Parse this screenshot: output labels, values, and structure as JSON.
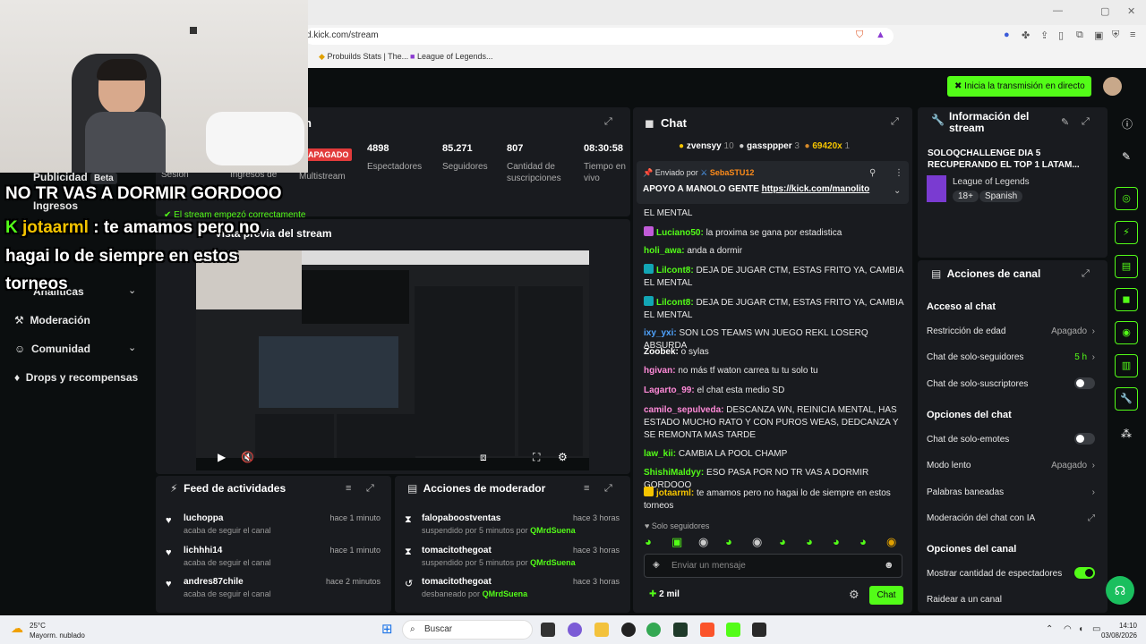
{
  "browser": {
    "url": "d.kick.com/stream",
    "bookmarks": [
      "Probuilds Stats | The...",
      "League of Legends..."
    ]
  },
  "header": {
    "golive_label": "Inicia la transmisión en directo"
  },
  "sidebar": {
    "items": [
      {
        "label": "Publicidad",
        "badge": "Beta"
      },
      {
        "label": "Ingresos"
      },
      {
        "label": "Analíticas"
      },
      {
        "label": "Moderación"
      },
      {
        "label": "Comunidad"
      },
      {
        "label": "Drops y recompensas"
      }
    ]
  },
  "stream_panel": {
    "title": "n",
    "status": "El stream empezó correctamente",
    "sesion_label": "Sesión",
    "ingresos_label": "Ingresos de",
    "paid_badge": "APAGADO",
    "multistream": "Multistream",
    "stats": [
      {
        "value": "4898",
        "label": "Espectadores"
      },
      {
        "value": "85.271",
        "label": "Seguidores"
      },
      {
        "value": "807",
        "label": "Cantidad de suscripciones"
      },
      {
        "value": "08:30:58",
        "label": "Tiempo en vivo"
      }
    ],
    "preview_title": "Vista previa del stream"
  },
  "activity_feed": {
    "title": "Feed de actividades",
    "rows": [
      {
        "name": "luchoppa",
        "sub": "acaba de seguir el canal",
        "time": "hace 1 minuto"
      },
      {
        "name": "lichhhi14",
        "sub": "acaba de seguir el canal",
        "time": "hace 1 minuto"
      },
      {
        "name": "andres87chile",
        "sub": "acaba de seguir el canal",
        "time": "hace 2 minutos"
      }
    ]
  },
  "mod_actions": {
    "title": "Acciones de moderador",
    "rows": [
      {
        "name": "falopaboostventas",
        "sub": "suspendido por 5 minutos por",
        "by": "QMrdSuena",
        "time": "hace 3 horas"
      },
      {
        "name": "tomacitothegoat",
        "sub": "suspendido por 5 minutos por",
        "by": "QMrdSuena",
        "time": "hace 3 horas"
      },
      {
        "name": "tomacitothegoat",
        "sub": "desbaneado por",
        "by": "QMrdSuena",
        "time": "hace 3 horas"
      }
    ]
  },
  "chat": {
    "title": "Chat",
    "top_gifters": [
      {
        "name": "zvensyy",
        "count": "10"
      },
      {
        "name": "gassppper",
        "count": "3"
      },
      {
        "name": "69420x",
        "count": "1"
      }
    ],
    "pinned": {
      "by_label": "Enviado por",
      "by": "SebaSTU12",
      "text": "APOYO A MANOLO GENTE",
      "link": "https://kick.com/manolito"
    },
    "messages": [
      {
        "user": "",
        "text": "EL MENTAL",
        "color": "#e8e8e8"
      },
      {
        "user": "Luciano50:",
        "text": "la proxima se gana por estadistica",
        "color": "#53fc18"
      },
      {
        "user": "holi_awa:",
        "text": "anda a dormir",
        "color": "#53fc18"
      },
      {
        "user": "Lilcont8:",
        "text": "DEJA DE JUGAR CTM, ESTAS FRITO YA, CAMBIA EL MENTAL",
        "color": "#53fc18"
      },
      {
        "user": "Lilcont8:",
        "text": "DEJA DE JUGAR CTM, ESTAS FRITO YA, CAMBIA EL MENTAL",
        "color": "#53fc18"
      },
      {
        "user": "ixy_yxi:",
        "text": "SON LOS TEAMS WN JUEGO REKL LOSERQ ABSURDA",
        "color": "#4fa3ff"
      },
      {
        "user": "Zoobek:",
        "text": "o sylas",
        "color": "#ffffff"
      },
      {
        "user": "hgivan:",
        "text": "no más tf waton carrea tu tu solo tu",
        "color": "#ff8ad8"
      },
      {
        "user": "Lagarto_99:",
        "text": "el chat esta medio SD",
        "color": "#ff8ad8"
      },
      {
        "user": "camilo_sepulveda:",
        "text": "DESCANZA WN, REINICIA MENTAL, HAS ESTADO MUCHO RATO Y CON PUROS WEAS, DEDCANZA Y SE REMONTA MAS TARDE",
        "color": "#ff8ad8"
      },
      {
        "user": "law_kii:",
        "text": "CAMBIA LA POOL CHAMP",
        "color": "#53fc18"
      },
      {
        "user": "ShishiMaldyy:",
        "text": "ESO PASA POR NO TR VAS A DORMIR GORDOOO",
        "color": "#53fc18"
      },
      {
        "user": "jotaarml:",
        "text": "te amamos pero no hagai lo de siempre en estos torneos",
        "color": "#f5c400"
      }
    ],
    "followers_only": "Solo seguidores",
    "input_placeholder": "Enviar un mensaje",
    "viewer_count": "2 mil",
    "send_label": "Chat"
  },
  "stream_info": {
    "title": "Información del stream",
    "stream_title": "SOLOQCHALLENGE DIA 5 RECUPERANDO EL TOP 1 LATAM...",
    "category": "League of Legends",
    "tags": [
      "18+",
      "Spanish"
    ]
  },
  "channel_actions": {
    "title": "Acciones de canal",
    "sections": {
      "chat_access": "Acceso al chat",
      "chat_options": "Opciones del chat",
      "channel_options": "Opciones del canal"
    },
    "rows": {
      "age": {
        "label": "Restricción de edad",
        "value": "Apagado"
      },
      "followers": {
        "label": "Chat de solo-seguidores",
        "value": "5 h"
      },
      "subs": {
        "label": "Chat de solo-suscriptores"
      },
      "emotes": {
        "label": "Chat de solo-emotes"
      },
      "slow": {
        "label": "Modo lento",
        "value": "Apagado"
      },
      "banned": {
        "label": "Palabras baneadas"
      },
      "ai": {
        "label": "Moderación del chat con IA"
      },
      "viewers": {
        "label": "Mostrar cantidad de espectadores"
      },
      "raid": {
        "label": "Raidear a un canal"
      }
    }
  },
  "overlay": {
    "line1": "NO TR VAS A DORMIR GORDOOO",
    "user": "jotaarml",
    "line2": ": te amamos pero no",
    "line3": "hagai lo de siempre en estos",
    "line4": "torneos"
  },
  "taskbar": {
    "weather_temp": "25°C",
    "weather_desc": "Mayorm. nublado",
    "search": "Buscar",
    "time": "14:10",
    "date": "03/08/2026"
  }
}
